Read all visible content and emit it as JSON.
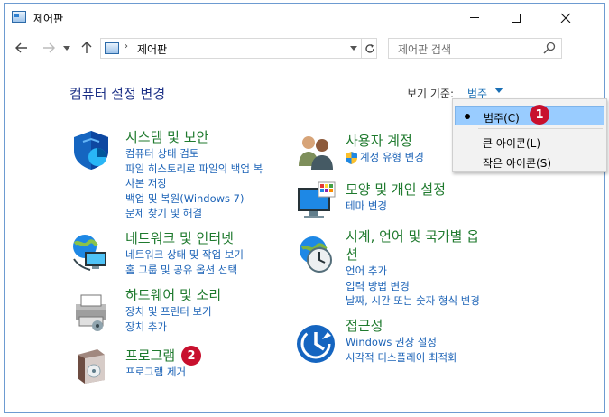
{
  "window": {
    "title": "제어판"
  },
  "address": {
    "path": "제어판",
    "separator": "›"
  },
  "search": {
    "placeholder": "제어판 검색"
  },
  "header": {
    "title": "컴퓨터 설정 변경",
    "viewby_label": "보기 기준:",
    "viewby_value": "범주"
  },
  "categories": [
    {
      "title": "시스템 및 보안",
      "icon": "shield-icon",
      "links": [
        "컴퓨터 상태 검토",
        "파일 히스토리로 파일의 백업 복",
        "사본 저장",
        "백업 및 복원(Windows 7)",
        "문제 찾기 및 해결"
      ]
    },
    {
      "title": "네트워크 및 인터넷",
      "icon": "network-icon",
      "links": [
        "네트워크 상태 및 작업 보기",
        "홈 그룹 및 공유 옵션 선택"
      ]
    },
    {
      "title": "하드웨어 및 소리",
      "icon": "printer-icon",
      "links": [
        "장치 및 프린터 보기",
        "장치 추가"
      ]
    },
    {
      "title": "프로그램",
      "icon": "programs-icon",
      "links": [
        "프로그램 제거"
      ]
    },
    {
      "title": "사용자 계정",
      "icon": "users-icon",
      "links": [
        "계정 유형 변경"
      ]
    },
    {
      "title": "모양 및 개인 설정",
      "icon": "monitor-icon",
      "links": [
        "테마 변경"
      ]
    },
    {
      "title": "시계, 언어 및 국가별 옵",
      "title2": "션",
      "icon": "clock-globe-icon",
      "links": [
        "언어 추가",
        "입력 방법 변경",
        "날짜, 시간 또는 숫자 형식 변경"
      ]
    },
    {
      "title": "접근성",
      "icon": "accessibility-icon",
      "links": [
        "Windows 권장 설정",
        "시각적 디스플레이 최적화"
      ]
    }
  ],
  "menu": {
    "items": [
      "범주(C)",
      "큰 아이콘(L)",
      "작은 아이콘(S)"
    ],
    "selected": 0
  },
  "badges": [
    "1",
    "2"
  ],
  "colors": {
    "title_green": "#1f7a2e",
    "link_blue": "#1c63b7",
    "header_blue": "#1e3287",
    "badge_red": "#c8102e",
    "menu_highlight": "#99ccff"
  }
}
